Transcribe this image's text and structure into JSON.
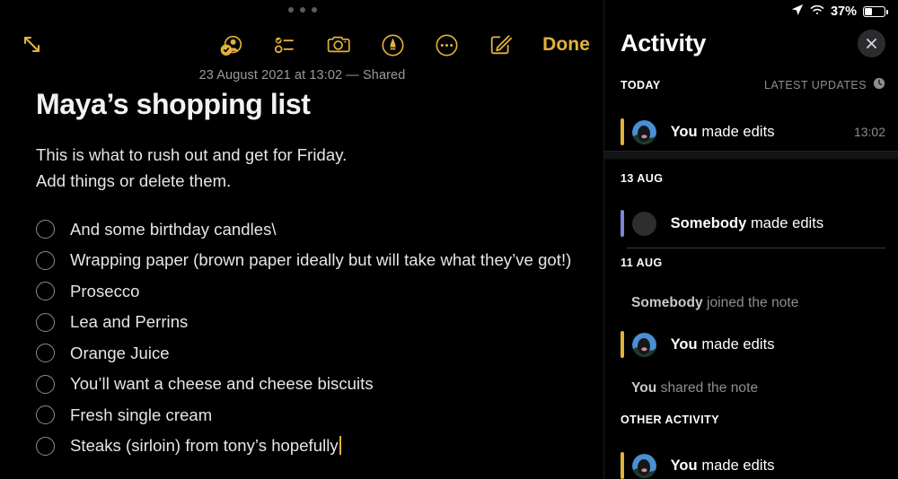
{
  "note": {
    "grabber_icon": "multitask-grabber-dots",
    "toolbar": {
      "expand_icon": "expand-diagonal-arrows-icon",
      "share_icon": "person-check-shared-icon",
      "checklist_icon": "checklist-icon",
      "camera_icon": "camera-icon",
      "markup_icon": "markup-pen-circle-icon",
      "more_icon": "more-ellipsis-circle-icon",
      "compose_icon": "compose-pencil-square-icon",
      "done_label": "Done",
      "accent_color": "#e3b23c"
    },
    "meta": "23 August 2021 at 13:02 — Shared",
    "title": "Maya’s shopping list",
    "paragraph_lines": [
      "This is what to rush out and get for Friday.",
      "Add things or delete them."
    ],
    "checklist": [
      {
        "label": "And some birthday candles\\",
        "checked": false,
        "caret": false
      },
      {
        "label": "Wrapping paper (brown paper ideally but will take what they’ve got!)",
        "checked": false,
        "caret": false
      },
      {
        "label": "Prosecco",
        "checked": false,
        "caret": false
      },
      {
        "label": "Lea and Perrins",
        "checked": false,
        "caret": false
      },
      {
        "label": "Orange Juice",
        "checked": false,
        "caret": false
      },
      {
        "label": "You’ll want a cheese and cheese biscuits",
        "checked": false,
        "caret": false
      },
      {
        "label": "Fresh single cream",
        "checked": false,
        "caret": false
      },
      {
        "label": "Steaks (sirloin) from tony’s hopefully",
        "checked": false,
        "caret": true
      }
    ]
  },
  "activity": {
    "statusbar": {
      "location_icon": "location-arrow-icon",
      "wifi_icon": "wifi-icon",
      "battery_percent": "37%",
      "battery_level": 37,
      "battery_icon": "battery-icon"
    },
    "title": "Activity",
    "close_icon": "close-x-icon",
    "clock_icon": "clock-icon",
    "gold_color": "#e3b23c",
    "blue_color": "#7b87d4",
    "sections": [
      {
        "title": "TODAY",
        "right_label": "LATEST UPDATES",
        "rows": [
          {
            "kind": "avatar",
            "who": "You",
            "action": "made edits",
            "time": "13:02",
            "bar": "gold",
            "avatar": "photo"
          }
        ]
      },
      {
        "title": "13 AUG",
        "right_label": "",
        "rows": [
          {
            "kind": "avatar",
            "who": "Somebody",
            "action": "made edits",
            "time": "",
            "bar": "blue",
            "avatar": "blank"
          }
        ]
      },
      {
        "title": "11 AUG",
        "right_label": "",
        "rows": [
          {
            "kind": "plain",
            "who": "Somebody",
            "action": "joined the note"
          },
          {
            "kind": "avatar",
            "who": "You",
            "action": "made edits",
            "time": "",
            "bar": "gold",
            "avatar": "photo"
          },
          {
            "kind": "plain",
            "who": "You",
            "action": "shared the note"
          }
        ]
      },
      {
        "title": "OTHER ACTIVITY",
        "right_label": "",
        "rows": [
          {
            "kind": "avatar",
            "who": "You",
            "action": "made edits",
            "time": "",
            "bar": "gold",
            "avatar": "photo"
          }
        ]
      }
    ]
  }
}
